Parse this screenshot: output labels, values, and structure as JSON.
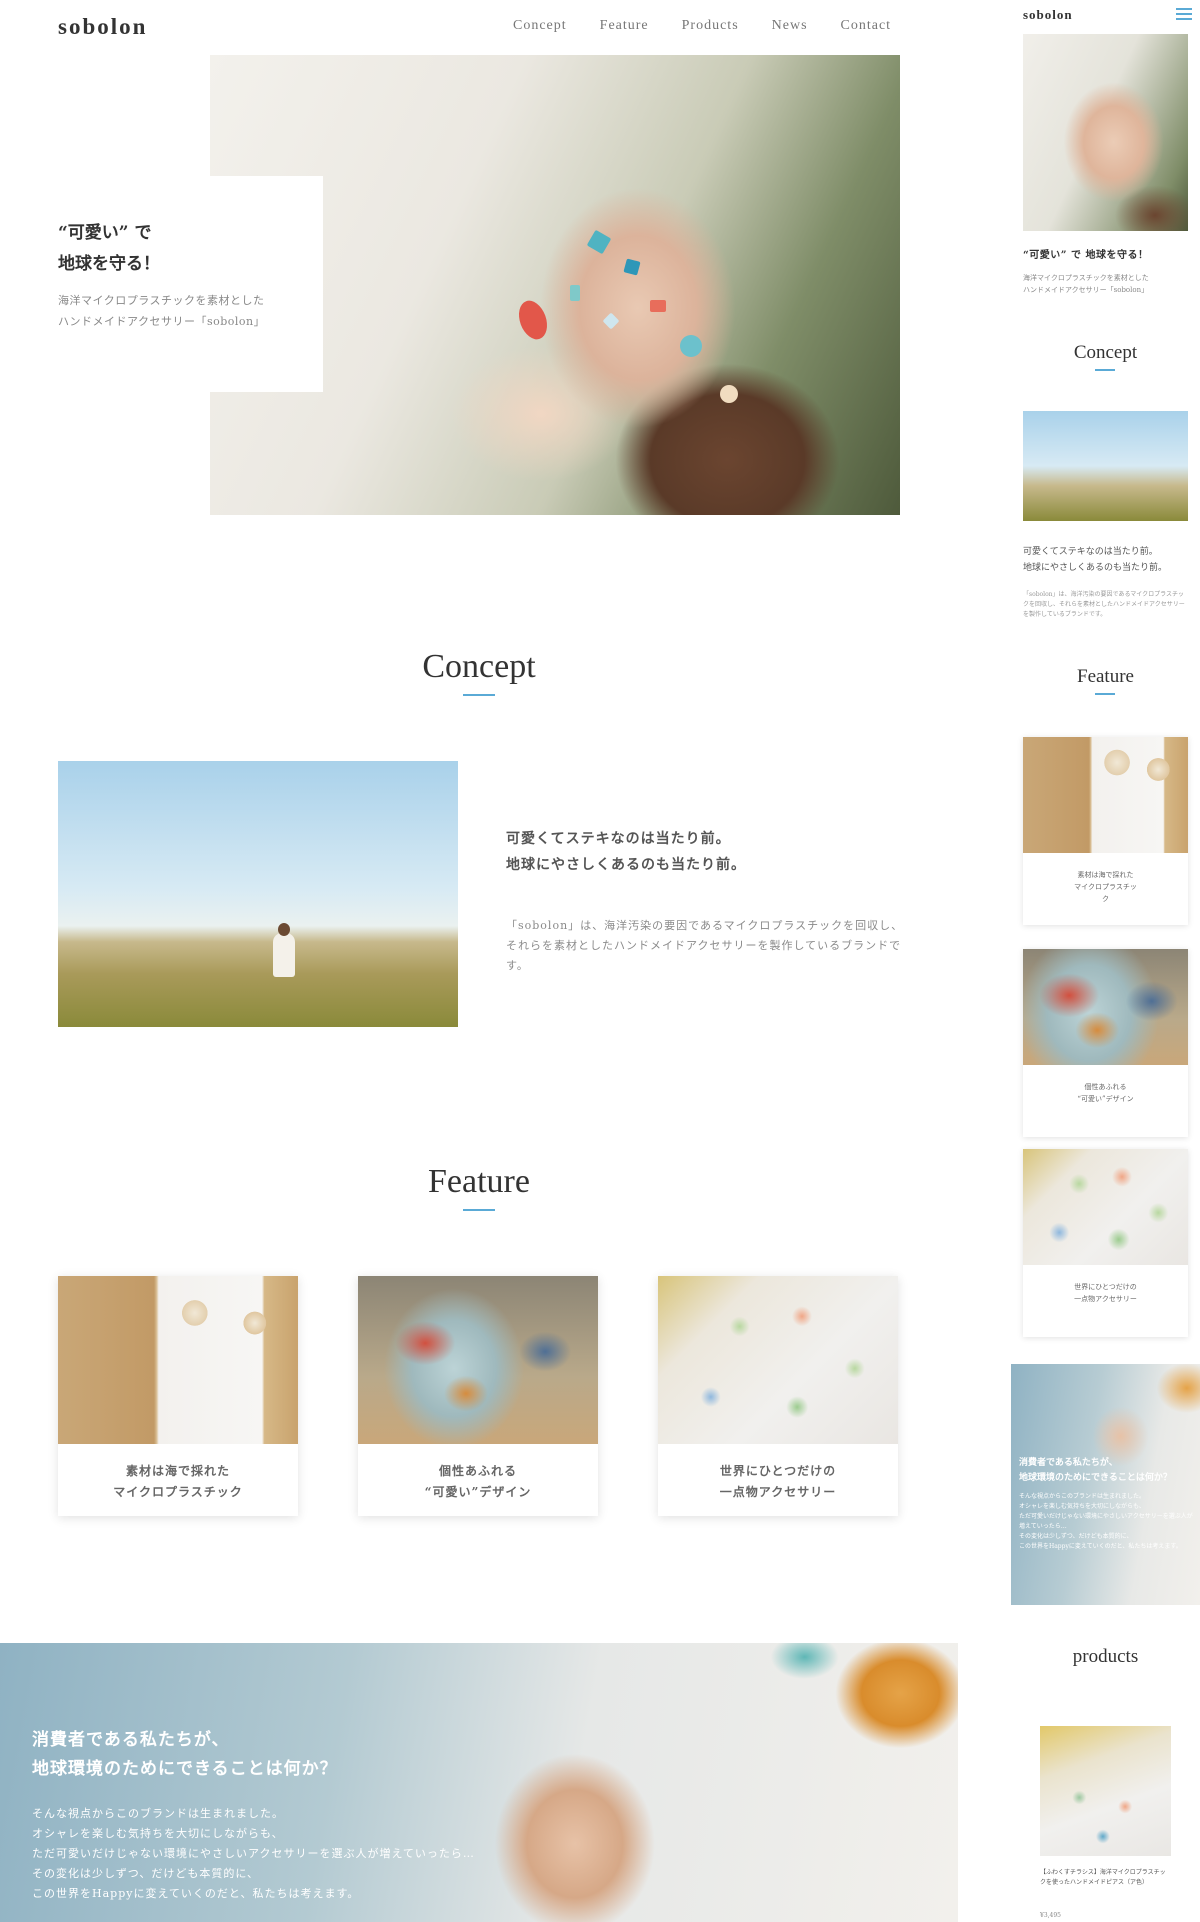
{
  "brand": {
    "logo": "sobolon",
    "accent": "#5aaad6"
  },
  "nav": {
    "items": [
      "Concept",
      "Feature",
      "Products",
      "News",
      "Contact"
    ]
  },
  "hero": {
    "title": "“可愛い” で\n地球を守る！",
    "subtitle": "海洋マイクロプラスチックを素材とした\nハンドメイドアクセサリー「sobolon」"
  },
  "concept": {
    "title": "Concept",
    "heading": "可愛くてステキなのは当たり前。\n地球にやさしくあるのも当たり前。",
    "body": "「sobolon」は、海洋汚染の要因であるマイクロプラスチックを回収し、それらを素材としたハンドメイドアクセサリーを製作しているブランドです。"
  },
  "feature": {
    "title": "Feature",
    "cards": [
      {
        "caption": "素材は海で採れた\nマイクロプラスチック"
      },
      {
        "caption": "個性あふれる\n“可愛い”デザイン"
      },
      {
        "caption": "世界にひとつだけの\n一点物アクセサリー"
      }
    ]
  },
  "banner": {
    "heading": "消費者である私たちが、\n地球環境のためにできることは何か？",
    "body": "そんな視点からこのブランドは生まれました。\nオシャレを楽しむ気持ちを大切にしながらも、\nただ可愛いだけじゃない環境にやさしいアクセサリーを選ぶ人が増えていったら…\nその変化は少しずつ、だけども本質的に、\nこの世界をHappyに変えていくのだと、私たちは考えます。"
  },
  "mobile": {
    "logo": "sobolon",
    "menu_icon": "hamburger-icon",
    "hero_title": "“可愛い” で 地球を守る！",
    "hero_subtitle": "海洋マイクロプラスチックを素材とした\nハンドメイドアクセサリー「sobolon」",
    "concept_title": "Concept",
    "concept_heading": "可愛くてステキなのは当たり前。\n地球にやさしくあるのも当たり前。",
    "concept_body": "「sobolon」は、海洋汚染の要因であるマイクロプラスチックを回収し、それらを素材としたハンドメイドアクセサリーを製作しているブランドです。",
    "feature_title": "Feature",
    "feature_cards": [
      {
        "caption": "素材は海で採れた\nマイクロプラスチッ\nク"
      },
      {
        "caption": "個性あふれる\n“可愛い”デザイン"
      },
      {
        "caption": "世界にひとつだけの\n一点物アクセサリー"
      }
    ],
    "banner_heading": "消費者である私たちが、\n地球環境のためにできることは何か？",
    "banner_body": "そんな視点からこのブランドは生まれました。\nオシャレを楽しむ気持ちを大切にしながらも、\nただ可愛いだけじゃない環境にやさしいアクセサリーを選ぶ人が増えていったら…\nその変化は少しずつ、だけども本質的に、\nこの世界をHappyに変えていくのだと、私たちは考えます。",
    "products_title": "products",
    "product_caption": "【ふわくすチラシス】海洋マイクロプラスチックを使ったハンドメイドピアス（ア色）",
    "product_price": "¥3,495"
  }
}
